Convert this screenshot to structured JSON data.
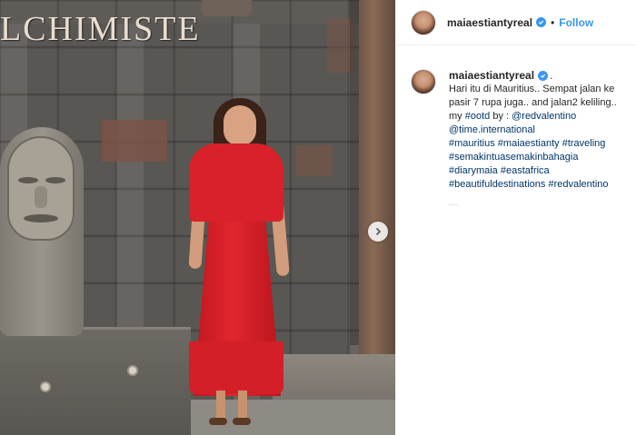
{
  "photo": {
    "sign_text": "LCHIMISTE",
    "carousel_next_icon": "chevron-right-icon"
  },
  "post": {
    "username": "maiaestiantyreal",
    "verified_icon": "verified-badge-icon",
    "separator": "•",
    "follow_label": "Follow"
  },
  "caption": {
    "username": "maiaestiantyreal",
    "separator": ".",
    "line1": "Hari itu di Mauritius.. Sempat jalan ke",
    "line2": "pasir 7 rupa juga.. and jalan2 keliling..",
    "line3_prefix": "my ",
    "line3_tag1": "#ootd",
    "line3_mid": " by : ",
    "line3_tag2": "@redvalentino",
    "tags": [
      "@time.international",
      "#mauritius #maiaestianty #traveling",
      "#semakintuasemakinbahagia",
      "#diarymaia #eastafrica",
      "#beautifuldestinations #redvalentino"
    ]
  },
  "colors": {
    "link": "#3897f0",
    "hashtag": "#003569",
    "dress": "#d8212a"
  }
}
